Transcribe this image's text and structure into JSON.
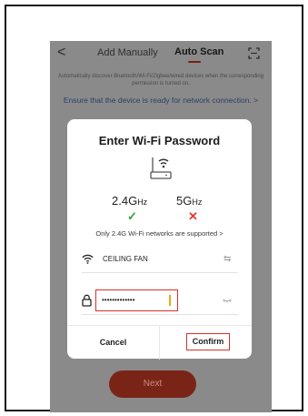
{
  "header": {
    "back_glyph": "<",
    "tab_manual": "Add Manually",
    "tab_auto": "Auto Scan",
    "icons": {
      "back": "back-icon",
      "scan": "scan-icon"
    }
  },
  "info": {
    "description": "Automatically discover Bluetooth/Wi-Fi/Zigbee/wired devices when the corresponding permission is turned on.",
    "ensure": "Ensure that the device is ready for network connection. >"
  },
  "dialog": {
    "title": "Enter Wi-Fi Password",
    "band_24": {
      "main": "2.4G",
      "unit": "Hz"
    },
    "band_5": {
      "main": "5G",
      "unit": "Hz"
    },
    "check_glyph": "✓",
    "cross_glyph": "✕",
    "support_note": "Only 2.4G Wi-Fi networks are supported >",
    "ssid": "CEILING FAN",
    "switch_glyph": "⇆",
    "password_masked": "•••••••••••••",
    "cancel_label": "Cancel",
    "confirm_label": "Confirm",
    "icons": {
      "router": "router-icon",
      "wifi": "wifi-icon",
      "switch": "switch-network-icon",
      "lock": "lock-icon",
      "eye": "eye-closed-icon"
    }
  },
  "footer": {
    "next_label": "Next"
  },
  "colors": {
    "accent": "#7a2418",
    "highlight": "#d3302e",
    "ok": "#2ea52e",
    "error": "#e53935",
    "overlay": "#8a8a8a"
  }
}
